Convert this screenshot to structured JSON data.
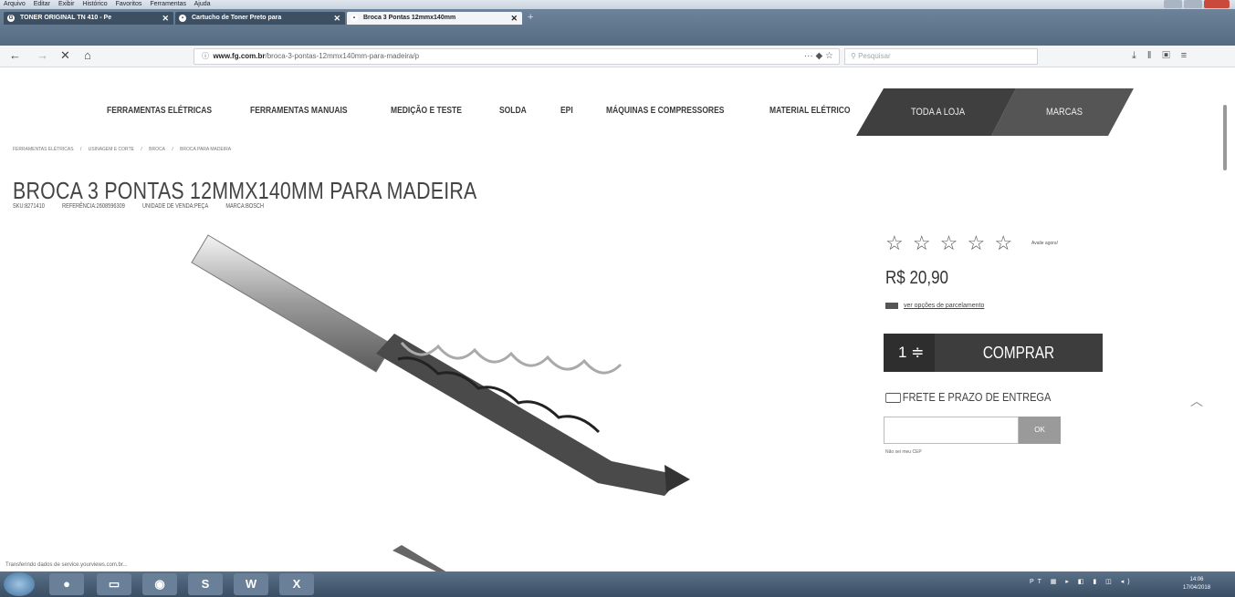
{
  "menubar": {
    "items": [
      "Arquivo",
      "Editar",
      "Exibir",
      "Histórico",
      "Favoritos",
      "Ferramentas",
      "Ajuda"
    ]
  },
  "tabs": [
    {
      "label": "TONER ORIGINAL TN 410 - Pe",
      "active": false
    },
    {
      "label": "Cartucho de Toner Preto para",
      "active": false
    },
    {
      "label": "Broca 3 Pontas 12mmx140mm",
      "active": true
    }
  ],
  "nav": {
    "url_domain": "www.fg.com.br",
    "url_path": "/broca-3-pontas-12mmx140mm-para-madeira/p",
    "search_placeholder": "Pesquisar"
  },
  "site_nav": {
    "items": [
      "FERRAMENTAS ELÉTRICAS",
      "FERRAMENTAS MANUAIS",
      "MEDIÇÃO E TESTE",
      "SOLDA",
      "EPI",
      "MÁQUINAS E COMPRESSORES",
      "MATERIAL ELÉTRICO"
    ],
    "all_store": "TODA A LOJA",
    "brands": "MARCAS"
  },
  "breadcrumb": [
    "FERRAMENTAS ELÉTRICAS",
    "/",
    "USINAGEM E CORTE",
    "/",
    "BROCA",
    "/",
    "BROCA PARA MADEIRA"
  ],
  "product": {
    "title": "BROCA 3 PONTAS 12MMX140MM PARA MADEIRA",
    "sku": "SKU:8271410",
    "reference": "REFERÊNCIA:2608596309",
    "unit": "UNIDADE DE VENDA:PEÇA",
    "brand": "MARCA:BOSCH",
    "stars": "☆ ☆ ☆ ☆ ☆",
    "rate_label": "Avalie agora!",
    "price": "R$ 20,90",
    "installments": "ver opções de parcelamento",
    "qty": "1 ≑",
    "buy": "COMPRAR",
    "shipping_title": "FRETE E PRAZO DE ENTREGA",
    "ok": "OK",
    "no_cep": "Não sei meu CEP"
  },
  "status": "Transferindo dados de service.yourviews.com.br...",
  "taskbar": {
    "tray": "PT",
    "time": "14:06",
    "date": "17/04/2018"
  }
}
